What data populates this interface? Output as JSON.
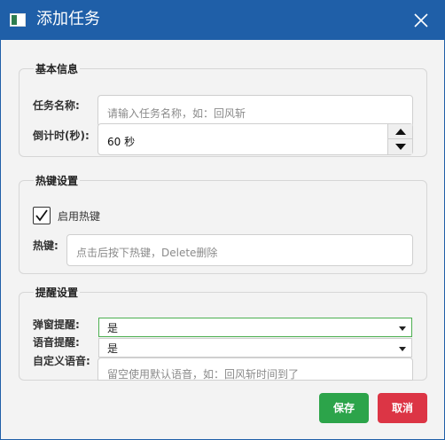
{
  "window": {
    "title": "添加任务"
  },
  "basic": {
    "group_title": "基本信息",
    "name_label": "任务名称:",
    "name_placeholder": "请输入任务名称，如：回风斩",
    "countdown_label": "倒计时(秒):",
    "countdown_value": "60 秒"
  },
  "hotkey": {
    "group_title": "热键设置",
    "enable_label": "启用热键",
    "enable_checked": true,
    "hotkey_label": "热键:",
    "hotkey_placeholder": "点击后按下热键，Delete删除"
  },
  "reminder": {
    "group_title": "提醒设置",
    "popup_label": "弹窗提醒:",
    "popup_value": "是",
    "voice_label": "语音提醒:",
    "voice_value": "是",
    "custom_voice_label": "自定义语音:",
    "custom_voice_placeholder": "留空使用默认语音，如：回风斩时间到了"
  },
  "buttons": {
    "save": "保存",
    "cancel": "取消"
  },
  "colors": {
    "titlebar": "#1f5fa8",
    "save": "#2ca44a",
    "cancel": "#dc3545",
    "focus_border": "#4caf50"
  }
}
